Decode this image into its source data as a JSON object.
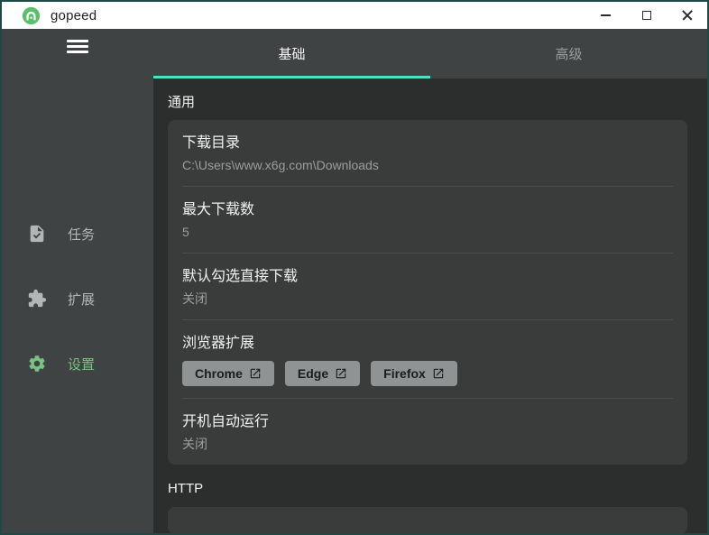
{
  "window": {
    "title": "gopeed",
    "controls": [
      "minimize",
      "maximize",
      "close"
    ]
  },
  "colors": {
    "accent_underline": "#52e0c5",
    "active_green": "#79c282",
    "logo_green": "#5abf6a",
    "border_teal": "#1d4b44",
    "titlebar_bg": "#ffffff",
    "sidebar_bg": "#404343",
    "content_bg": "#2c2e2e",
    "card_bg": "#3a3c3c",
    "button_bg": "#8f9393"
  },
  "sidebar": {
    "menu_icon": "hamburger-menu-icon",
    "items": [
      {
        "label": "任务",
        "icon": "task-icon",
        "active": false
      },
      {
        "label": "扩展",
        "icon": "extension-icon",
        "active": false
      },
      {
        "label": "设置",
        "icon": "gear-icon",
        "active": true
      }
    ]
  },
  "tabs": [
    {
      "label": "基础",
      "active": true
    },
    {
      "label": "高级",
      "active": false
    }
  ],
  "sections": [
    {
      "label": "通用",
      "items": [
        {
          "title": "下载目录",
          "subtitle": "C:\\Users\\www.x6g.com\\Downloads"
        },
        {
          "title": "最大下载数",
          "subtitle": "5"
        },
        {
          "title": "默认勾选直接下载",
          "subtitle": "关闭"
        },
        {
          "title": "浏览器扩展",
          "buttons": [
            "Chrome",
            "Edge",
            "Firefox"
          ],
          "button_icon": "open-in-new-icon"
        },
        {
          "title": "开机自动运行",
          "subtitle": "关闭"
        }
      ]
    },
    {
      "label": "HTTP"
    }
  ]
}
